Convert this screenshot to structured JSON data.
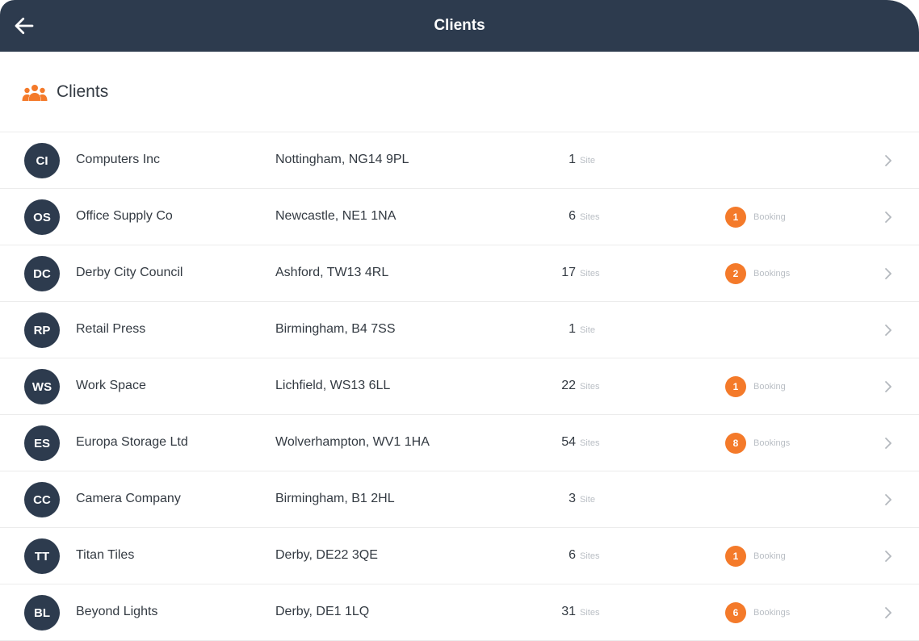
{
  "header": {
    "title": "Clients"
  },
  "section": {
    "title": "Clients",
    "icon": "group-icon",
    "accent": "#f47a2a"
  },
  "colors": {
    "navy": "#2d3b4e",
    "orange": "#f47a2a"
  },
  "clients": [
    {
      "initials": "CI",
      "name": "Computers Inc",
      "address": "Nottingham, NG14 9PL",
      "sites": "1",
      "sites_label": "Site",
      "bookings": "",
      "bookings_label": ""
    },
    {
      "initials": "OS",
      "name": "Office Supply Co",
      "address": "Newcastle, NE1 1NA",
      "sites": "6",
      "sites_label": "Sites",
      "bookings": "1",
      "bookings_label": "Booking"
    },
    {
      "initials": "DC",
      "name": "Derby City Council",
      "address": "Ashford, TW13 4RL",
      "sites": "17",
      "sites_label": "Sites",
      "bookings": "2",
      "bookings_label": "Bookings"
    },
    {
      "initials": "RP",
      "name": "Retail Press",
      "address": "Birmingham, B4 7SS",
      "sites": "1",
      "sites_label": "Site",
      "bookings": "",
      "bookings_label": ""
    },
    {
      "initials": "WS",
      "name": "Work Space",
      "address": "Lichfield, WS13 6LL",
      "sites": "22",
      "sites_label": "Sites",
      "bookings": "1",
      "bookings_label": "Booking"
    },
    {
      "initials": "ES",
      "name": "Europa Storage Ltd",
      "address": "Wolverhampton, WV1 1HA",
      "sites": "54",
      "sites_label": "Sites",
      "bookings": "8",
      "bookings_label": "Bookings"
    },
    {
      "initials": "CC",
      "name": "Camera Company",
      "address": "Birmingham, B1 2HL",
      "sites": "3",
      "sites_label": "Site",
      "bookings": "",
      "bookings_label": ""
    },
    {
      "initials": "TT",
      "name": "Titan Tiles",
      "address": "Derby, DE22 3QE",
      "sites": "6",
      "sites_label": "Sites",
      "bookings": "1",
      "bookings_label": "Booking"
    },
    {
      "initials": "BL",
      "name": "Beyond Lights",
      "address": "Derby, DE1 1LQ",
      "sites": "31",
      "sites_label": "Sites",
      "bookings": "6",
      "bookings_label": "Bookings"
    }
  ]
}
